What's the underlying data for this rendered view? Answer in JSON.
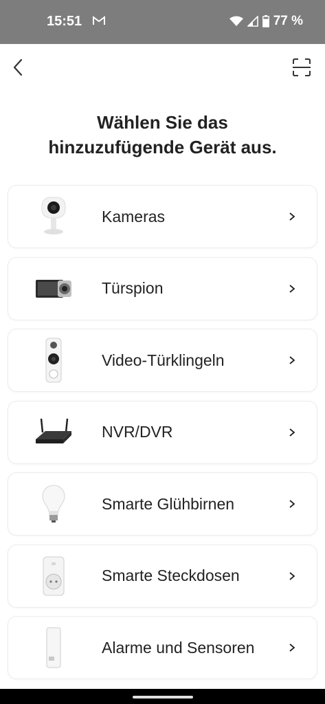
{
  "status": {
    "time": "15:51",
    "battery": "77 %"
  },
  "header": {
    "title_line1": "Wählen Sie das",
    "title_line2": "hinzuzufügende Gerät aus."
  },
  "devices": [
    {
      "label": "Kameras",
      "icon": "camera-icon"
    },
    {
      "label": "Türspion",
      "icon": "door-viewer-icon"
    },
    {
      "label": "Video-Türklingeln",
      "icon": "doorbell-icon"
    },
    {
      "label": "NVR/DVR",
      "icon": "nvr-icon"
    },
    {
      "label": "Smarte Glühbirnen",
      "icon": "bulb-icon"
    },
    {
      "label": "Smarte Steckdosen",
      "icon": "plug-icon"
    },
    {
      "label": "Alarme und Sensoren",
      "icon": "sensor-icon"
    }
  ]
}
